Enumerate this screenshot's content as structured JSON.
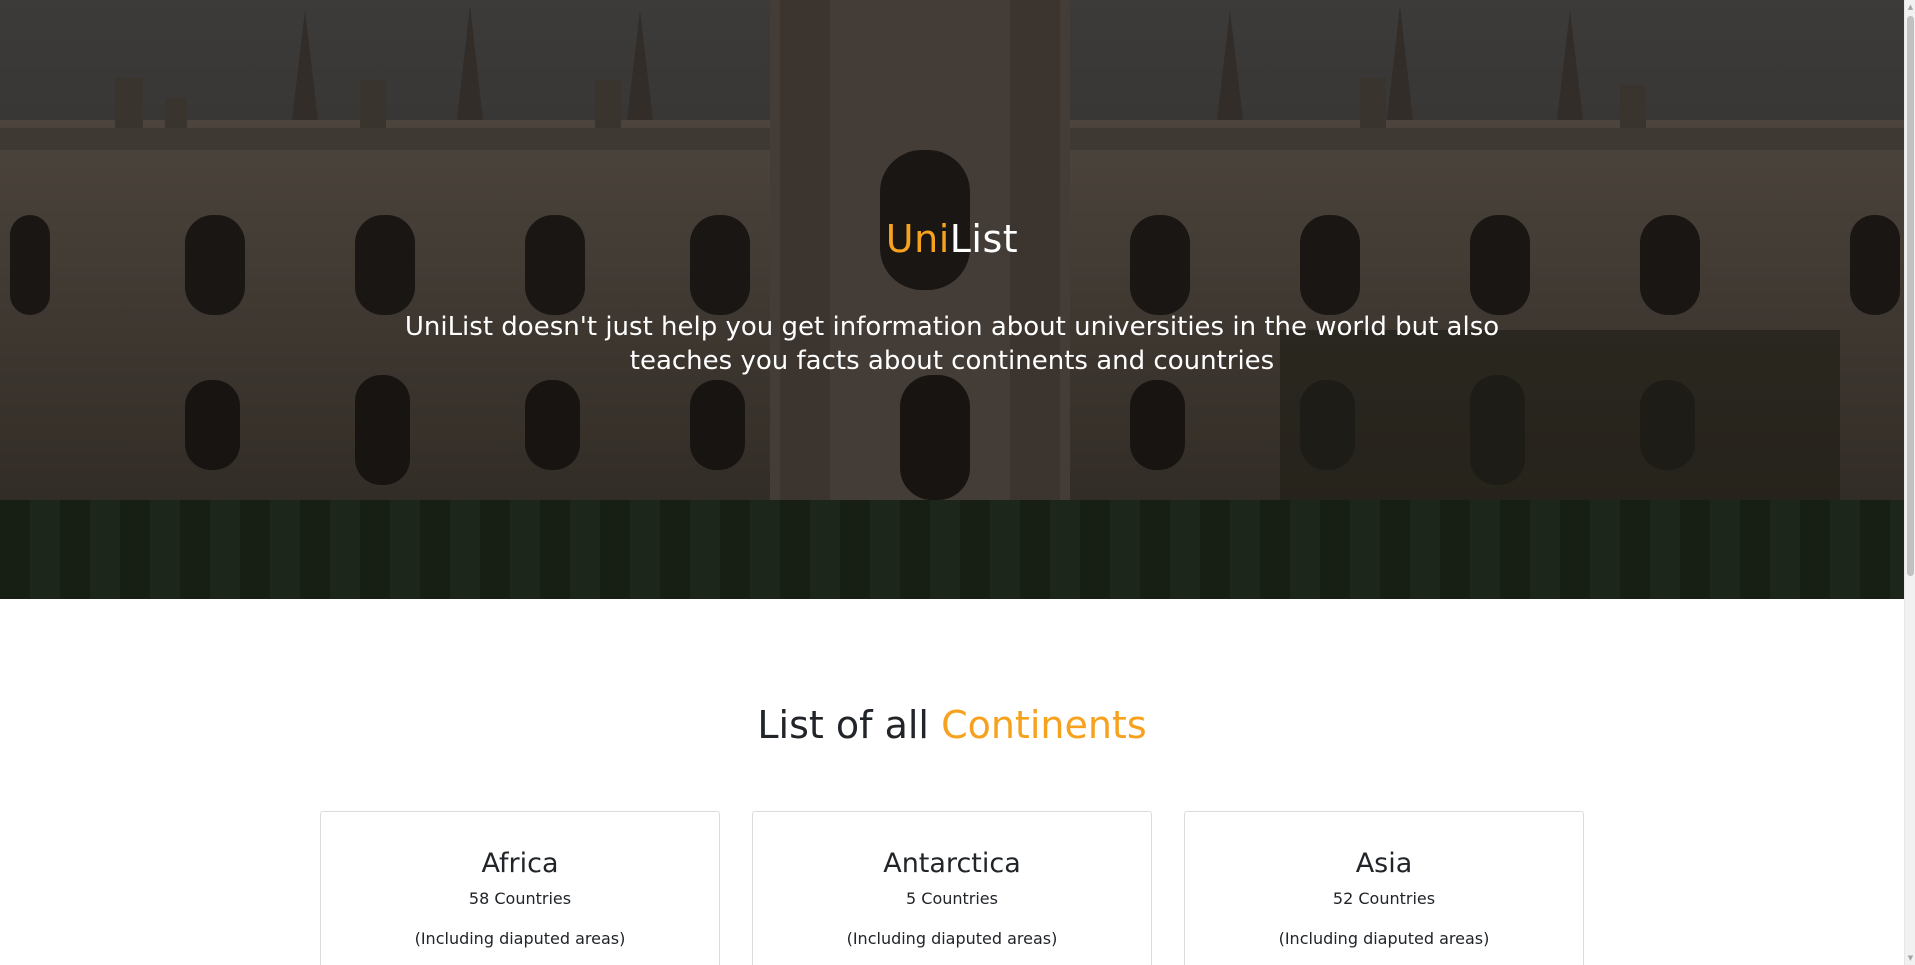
{
  "hero": {
    "title_accent": "Uni",
    "title_rest": "List",
    "tagline": "UniList doesn't just help you get information about universities in the world but also teaches you facts about continents and countries",
    "background": "photo of a gothic university college building at dusk with dark overlay"
  },
  "continents_section": {
    "title_prefix": "List of all ",
    "title_accent": "Continents",
    "cards": [
      {
        "name": "Africa",
        "countries": "58 Countries",
        "note": "(Including diaputed areas)"
      },
      {
        "name": "Antarctica",
        "countries": "5 Countries",
        "note": "(Including diaputed areas)"
      },
      {
        "name": "Asia",
        "countries": "52 Countries",
        "note": "(Including diaputed areas)"
      }
    ]
  },
  "colors": {
    "accent": "#f6a21e",
    "text": "#212529",
    "hero_text": "#ffffff"
  }
}
